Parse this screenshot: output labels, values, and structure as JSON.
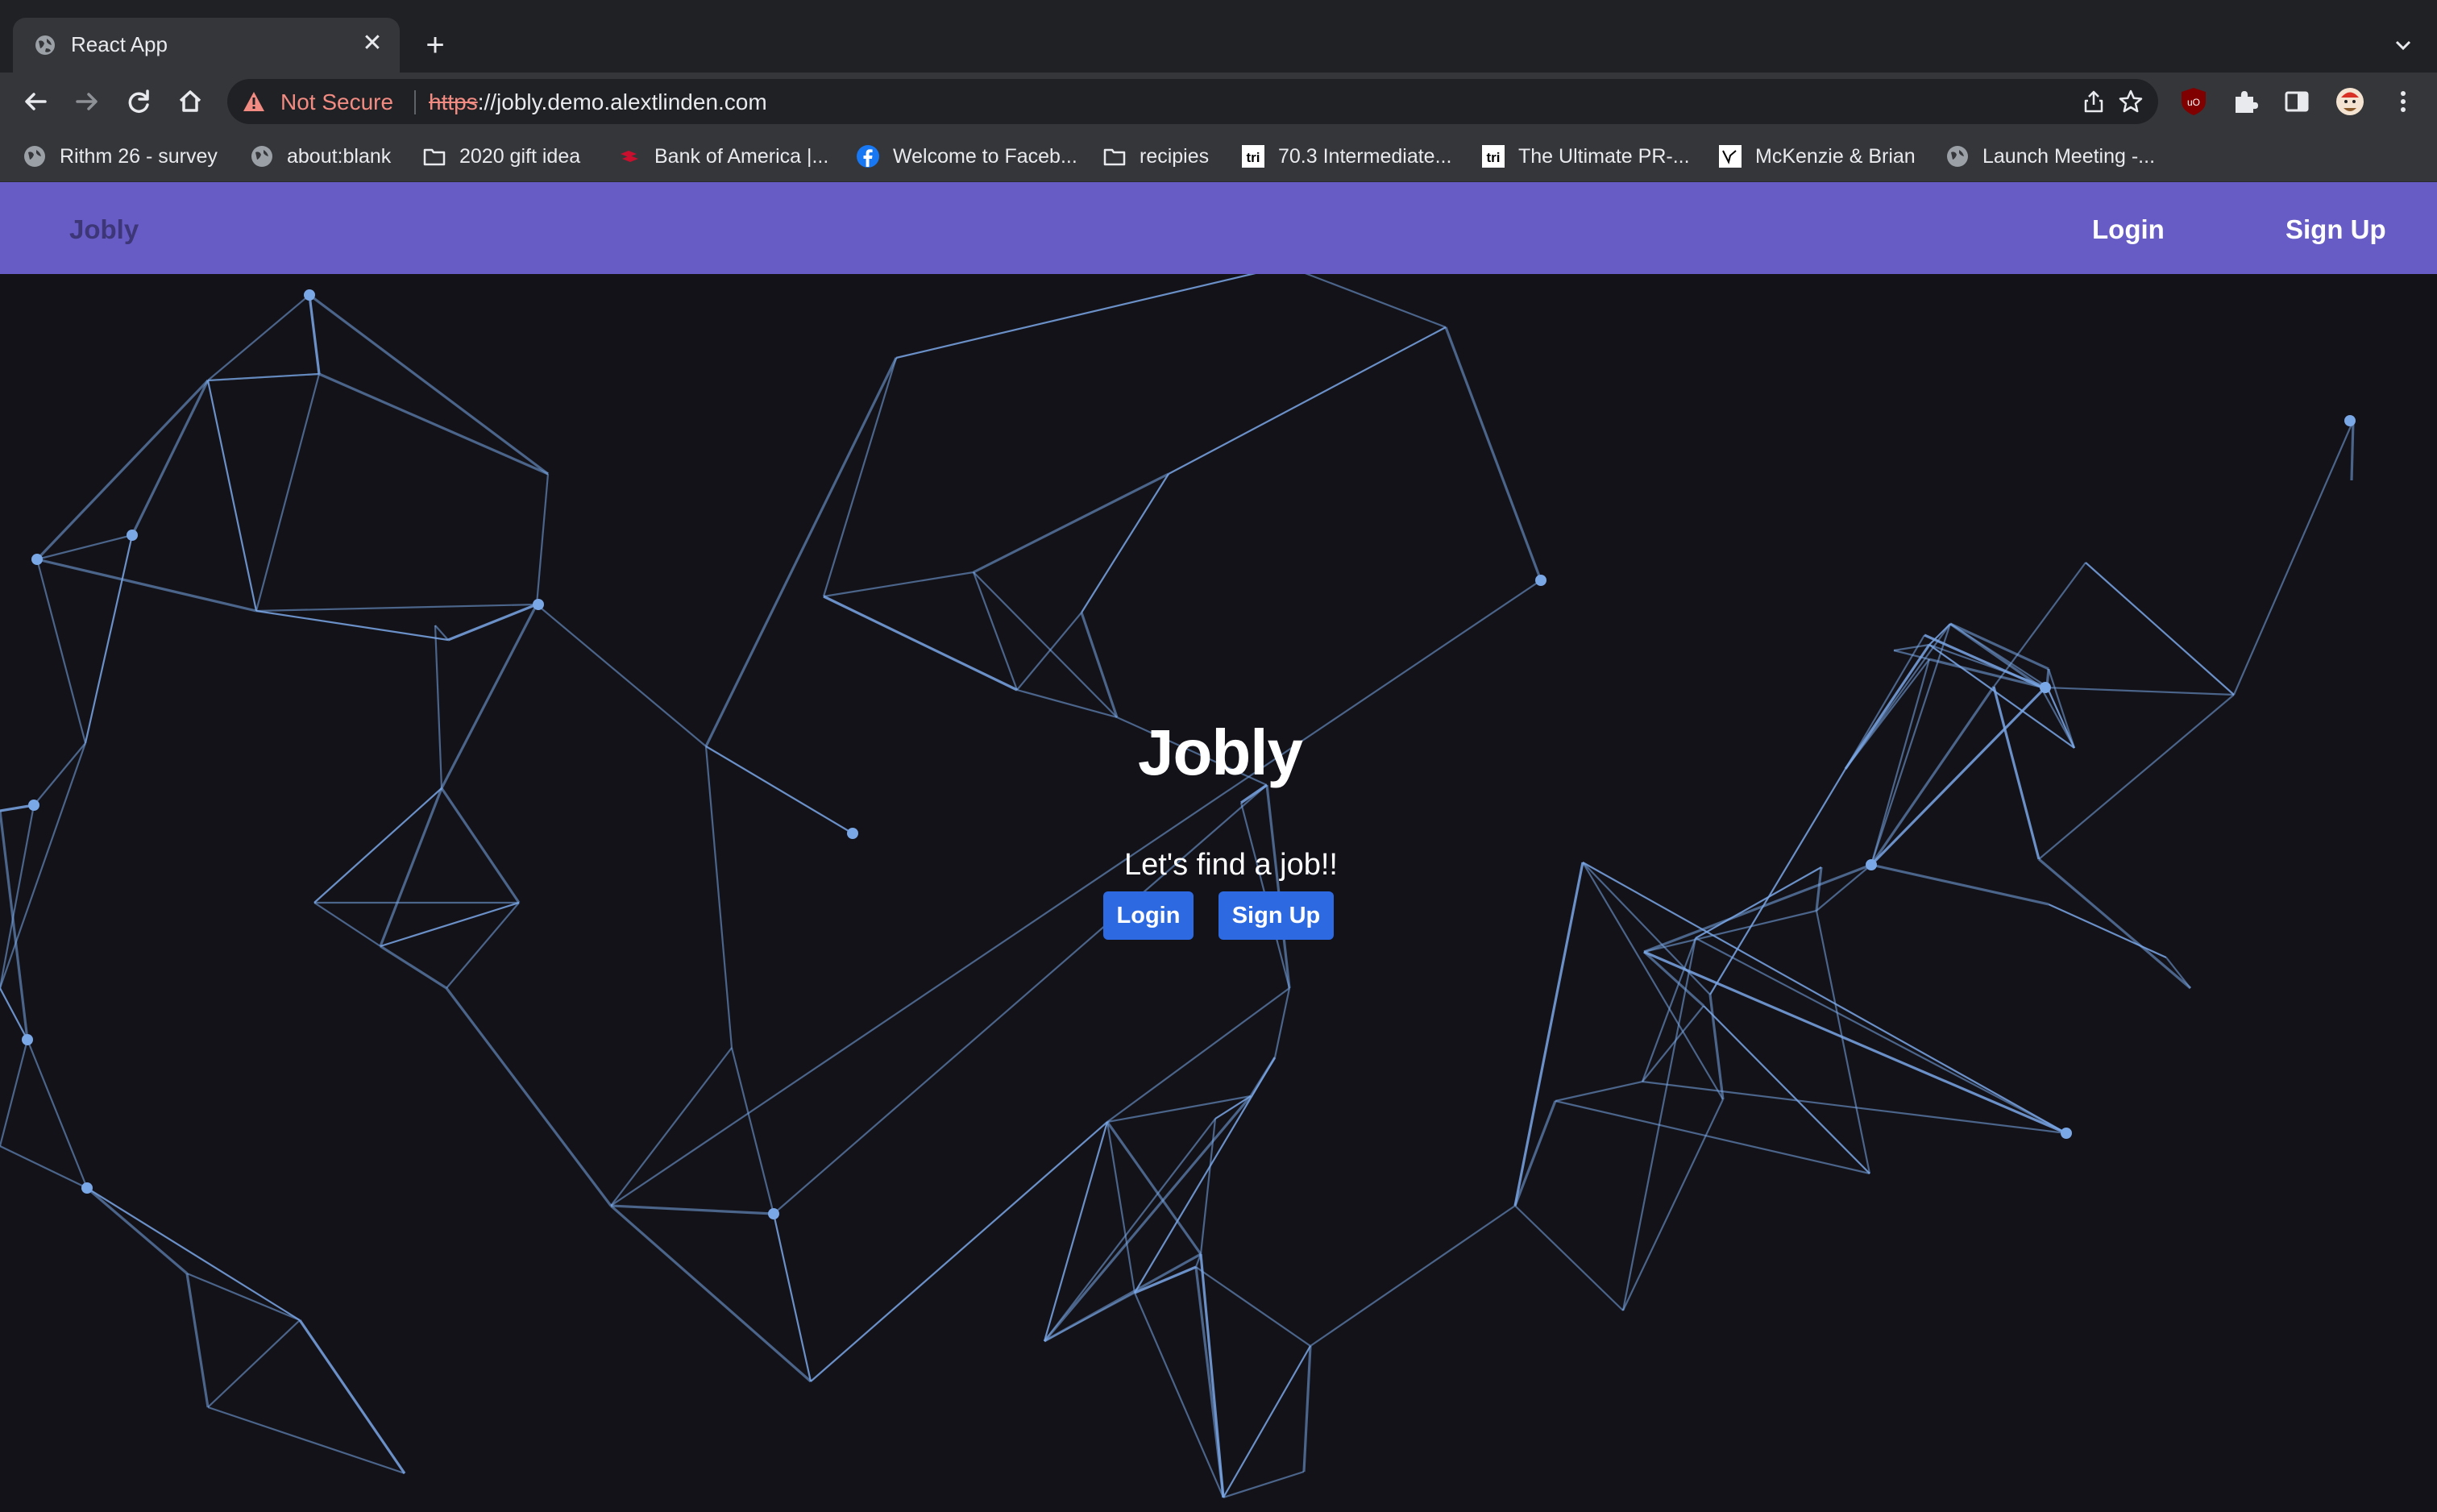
{
  "tab": {
    "title": "React App",
    "close_glyph": "✕",
    "new_tab_glyph": "+"
  },
  "omnibox": {
    "security_label": "Not Secure",
    "url_scheme": "https",
    "url_rest": "://jobly.demo.alextlinden.com"
  },
  "bookmarks": [
    {
      "label": "Rithm 26 - survey",
      "icon": "globe-icon"
    },
    {
      "label": "about:blank",
      "icon": "globe-icon"
    },
    {
      "label": "2020 gift idea",
      "icon": "folder-icon"
    },
    {
      "label": "Bank of America |...",
      "icon": "bank-of-america-icon"
    },
    {
      "label": "Welcome to Faceb...",
      "icon": "facebook-icon"
    },
    {
      "label": "recipies",
      "icon": "folder-icon"
    },
    {
      "label": "70.3 Intermediate...",
      "icon": "tri-icon"
    },
    {
      "label": "The Ultimate PR-...",
      "icon": "tri-icon"
    },
    {
      "label": "McKenzie & Brian",
      "icon": "wedding-site-icon"
    },
    {
      "label": "Launch Meeting -...",
      "icon": "globe-icon"
    }
  ],
  "navbar": {
    "brand": "Jobly",
    "login": "Login",
    "signup": "Sign Up"
  },
  "hero": {
    "title": "Jobly",
    "subtitle": "Let's find a job!!",
    "login": "Login",
    "signup": "Sign Up"
  },
  "colors": {
    "navbar": "#675bc6",
    "background": "#131219",
    "button": "#2d69e0",
    "network_line": "#7aa7e6",
    "not_secure": "#f28b82"
  }
}
